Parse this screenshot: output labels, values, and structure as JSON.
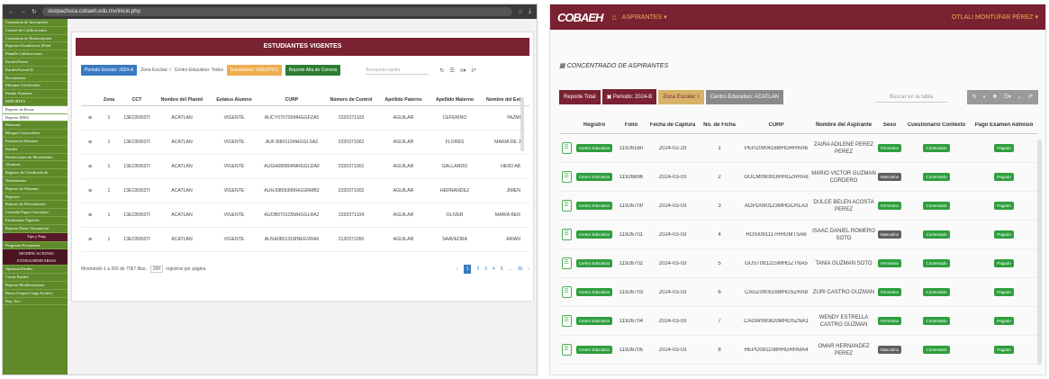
{
  "left_screen": {
    "browser": {
      "url": "sicepachuca.cobaeh.edu.mx/inicio.php"
    },
    "sidebar": {
      "items": [
        {
          "label": "Constancia de Inscripción",
          "style": "normal"
        },
        {
          "label": "Control de Calificaciones",
          "style": "normal"
        },
        {
          "label": "Constancia de Reinscripción",
          "style": "normal"
        },
        {
          "label": "Reportes Estadísticos (Pend",
          "style": "normal"
        },
        {
          "label": "Planilla Calificaciones",
          "style": "normal"
        },
        {
          "label": "KardexNuevo",
          "style": "normal"
        },
        {
          "label": "KardexNuevoCE",
          "style": "normal"
        },
        {
          "label": "Documentos",
          "style": "normal"
        },
        {
          "label": "Eliminar Certificados",
          "style": "normal"
        },
        {
          "label": "Estado Alumnos",
          "style": "normal"
        },
        {
          "label": "REPORTES",
          "style": "normal"
        },
        {
          "label": "Reporte de Becas",
          "style": "white"
        },
        {
          "label": "Reporte IMSS",
          "style": "white"
        },
        {
          "label": "Bitacoras",
          "style": "normal"
        },
        {
          "label": "Bloques Curriculares",
          "style": "normal"
        },
        {
          "label": "Existencia Alumnos",
          "style": "normal"
        },
        {
          "label": "Kardex",
          "style": "normal"
        },
        {
          "label": "Resoluciones de Movimiento",
          "style": "normal"
        },
        {
          "label": "Alumnos",
          "style": "normal"
        },
        {
          "label": "Registro de Certificado de",
          "style": "normal"
        },
        {
          "label": "Terminación",
          "style": "normal"
        },
        {
          "label": "Reporte de Alumnos",
          "style": "normal"
        },
        {
          "label": "Reportes",
          "style": "normal"
        },
        {
          "label": "Reporte de Movimientos",
          "style": "normal"
        },
        {
          "label": "Consulta Pagos Conceptos",
          "style": "normal"
        },
        {
          "label": "Estudiantes Vigentes",
          "style": "normal"
        },
        {
          "label": "Reporte Datos Vacunación",
          "style": "normal"
        },
        {
          "label": "Tips y Faqs",
          "style": "dark"
        },
        {
          "label": "Preguntas Frecuentes",
          "style": "normal"
        },
        {
          "label": "MODIFICACIONES EXTRAORDINARIAS",
          "style": "darker"
        },
        {
          "label": "Apertura Kardex",
          "style": "normal"
        },
        {
          "label": "Cerrar Kardex",
          "style": "normal"
        },
        {
          "label": "Reporte Modificaciones",
          "style": "normal"
        },
        {
          "label": "Busca Grupos Carga Archivo",
          "style": "normal"
        },
        {
          "label": "Dep. Sec.",
          "style": "normal"
        }
      ]
    },
    "main": {
      "title": "ESTUDIANTES VIGENTES",
      "periodo": "Periodo Escolar: 2024-A",
      "zona": "Zona Escolar: l",
      "centro": "Centro Educativo: Todos",
      "estudiantes_btn": "Estudiantes VIGENTES",
      "reporte_btn": "Reporte Alta de Correos",
      "search_placeholder": "Búsqueda rápida",
      "columns": [
        "",
        "Zona",
        "CCT",
        "Nombre del Plantel",
        "Estatus Alumno",
        "CURP",
        "Número de Control",
        "Apellido Paterno",
        "Apellido Materno",
        "Nombre del Est"
      ],
      "rows": [
        {
          "zona": "1",
          "cct": "13ECB0037I",
          "plantel": "ACATLAN",
          "estatus": "VIGENTE",
          "curp": "AUCY070709MHGGFZA5",
          "control": "2320371103",
          "paterno": "AGUILAR",
          "materno": "CEFERINO",
          "nombre": "YAZMI"
        },
        {
          "zona": "1",
          "cct": "13ECB0037I",
          "plantel": "ACATLAN",
          "estatus": "VIGENTE",
          "curp": "AUFJ080111MHGGLSA2",
          "control": "2320371062",
          "paterno": "AGUILAR",
          "materno": "FLORES",
          "nombre": "MARIA DE J"
        },
        {
          "zona": "1",
          "cct": "13ECB0037I",
          "plantel": "ACATLAN",
          "estatus": "VIGENTE",
          "curp": "AUGH080804MHGGLDA0",
          "control": "2320371001",
          "paterno": "AGUILAR",
          "materno": "GALLARDO",
          "nombre": "HEIDI AB"
        },
        {
          "zona": "1",
          "cct": "13ECB0037I",
          "plantel": "ACATLAN",
          "estatus": "VIGENTE",
          "curp": "AUHJ080930MHGGRMB2",
          "control": "2320371002",
          "paterno": "AGUILAR",
          "materno": "HERNANDEZ",
          "nombre": "JIMEN"
        },
        {
          "zona": "1",
          "cct": "13ECB0037I",
          "plantel": "ACATLAN",
          "estatus": "VIGENTE",
          "curp": "AUOB070125MHGGLRA2",
          "control": "2320371104",
          "paterno": "AGUILAR",
          "materno": "OLIVER",
          "nombre": "MARIA BER"
        },
        {
          "zona": "1",
          "cct": "13ECB0037I",
          "plantel": "ACATLAN",
          "estatus": "VIGENTE",
          "curp": "AUSA080131MNEGVRA6",
          "control": "2120371050",
          "paterno": "AGUILAR",
          "materno": "SAAVEDRA",
          "nombre": "ARIAN"
        }
      ],
      "footer": "Mostrando 1 a 200 de 7067 filas.",
      "per_page": "200",
      "per_page_suffix": "registros por página",
      "pages": [
        "‹",
        "1",
        "2",
        "3",
        "4",
        "5",
        "...",
        "36",
        "›"
      ]
    }
  },
  "right_screen": {
    "header": {
      "logo": "COBAEH",
      "nav": "ASPIRANTES",
      "user": "OTLALI MONTUFAR PÉREZ"
    },
    "section_title": "CONCENTRADO DE ASPIRANTES",
    "toolbar": {
      "reporte": "Reporte Total",
      "periodo": "Periodo: 2024-B",
      "zona": "Zona Escolar: I",
      "centro": "Centro Educativo: ACATLAN",
      "search_placeholder": "Buscar en la tabla"
    },
    "columns": [
      "",
      "Registro",
      "Folio",
      "Fecha de Captura",
      "No. de Ficha",
      "CURP",
      "Nombre del Aspirante",
      "Sexo",
      "Cuestionario Contexto",
      "Pago Examen Admisió"
    ],
    "registro_badge": "Centro Educativo",
    "cuestionario_badge": "Contestado",
    "pago_badge": "Pagado",
    "rows": [
      {
        "folio": "11926160",
        "fecha": "2024-02-29",
        "ficha": "1",
        "curp": "PEPZ090416MHGRRRA6",
        "nombre": "ZAIRA ADILENE PEREZ PEREZ",
        "sexo": "Femenino"
      },
      {
        "folio": "11926696",
        "fecha": "2024-03-03",
        "ficha": "2",
        "curp": "GUCM090918HHGZRRA8",
        "nombre": "MARIO VICTOR GUZMAN CORDERO",
        "sexo": "Masculino"
      },
      {
        "folio": "11926700",
        "fecha": "2024-03-03",
        "ficha": "3",
        "curp": "AOPD090123MHGCRLA3",
        "nombre": "DULCE BELEN ACOSTA PEREZ",
        "sexo": "Femenino"
      },
      {
        "folio": "11926701",
        "fecha": "2024-03-03",
        "ficha": "4",
        "curp": "ROSI091117HHGMTSA6",
        "nombre": "ISAAC DANIEL ROMERO SOTO",
        "sexo": "Masculino"
      },
      {
        "folio": "11926702",
        "fecha": "2024-03-03",
        "ficha": "5",
        "curp": "GUST091215MHGZTNA5",
        "nombre": "TANIA GUZMAN SOTO",
        "sexo": "Femenino"
      },
      {
        "folio": "11926703",
        "fecha": "2024-03-03",
        "ficha": "6",
        "curp": "CAGZ090516MHGSZRA8",
        "nombre": "ZURI CASTRO GUZMAN",
        "sexo": "Femenino"
      },
      {
        "folio": "11926704",
        "fecha": "2024-03-03",
        "ficha": "7",
        "curp": "CAGW090620MHGSZNA1",
        "nombre": "WENDY ESTRELLA CASTRO GUZMAN",
        "sexo": "Femenino"
      },
      {
        "folio": "11926705",
        "fecha": "2024-03-03",
        "ficha": "8",
        "curp": "HEPO091108HHGRRMA4",
        "nombre": "OMAR HERNANDEZ PEREZ",
        "sexo": "Masculino"
      }
    ]
  },
  "colors": {
    "maroon": "#7a2132",
    "green": "#2e9e3e",
    "blue": "#3b79c2",
    "orange": "#f0ad4e"
  }
}
